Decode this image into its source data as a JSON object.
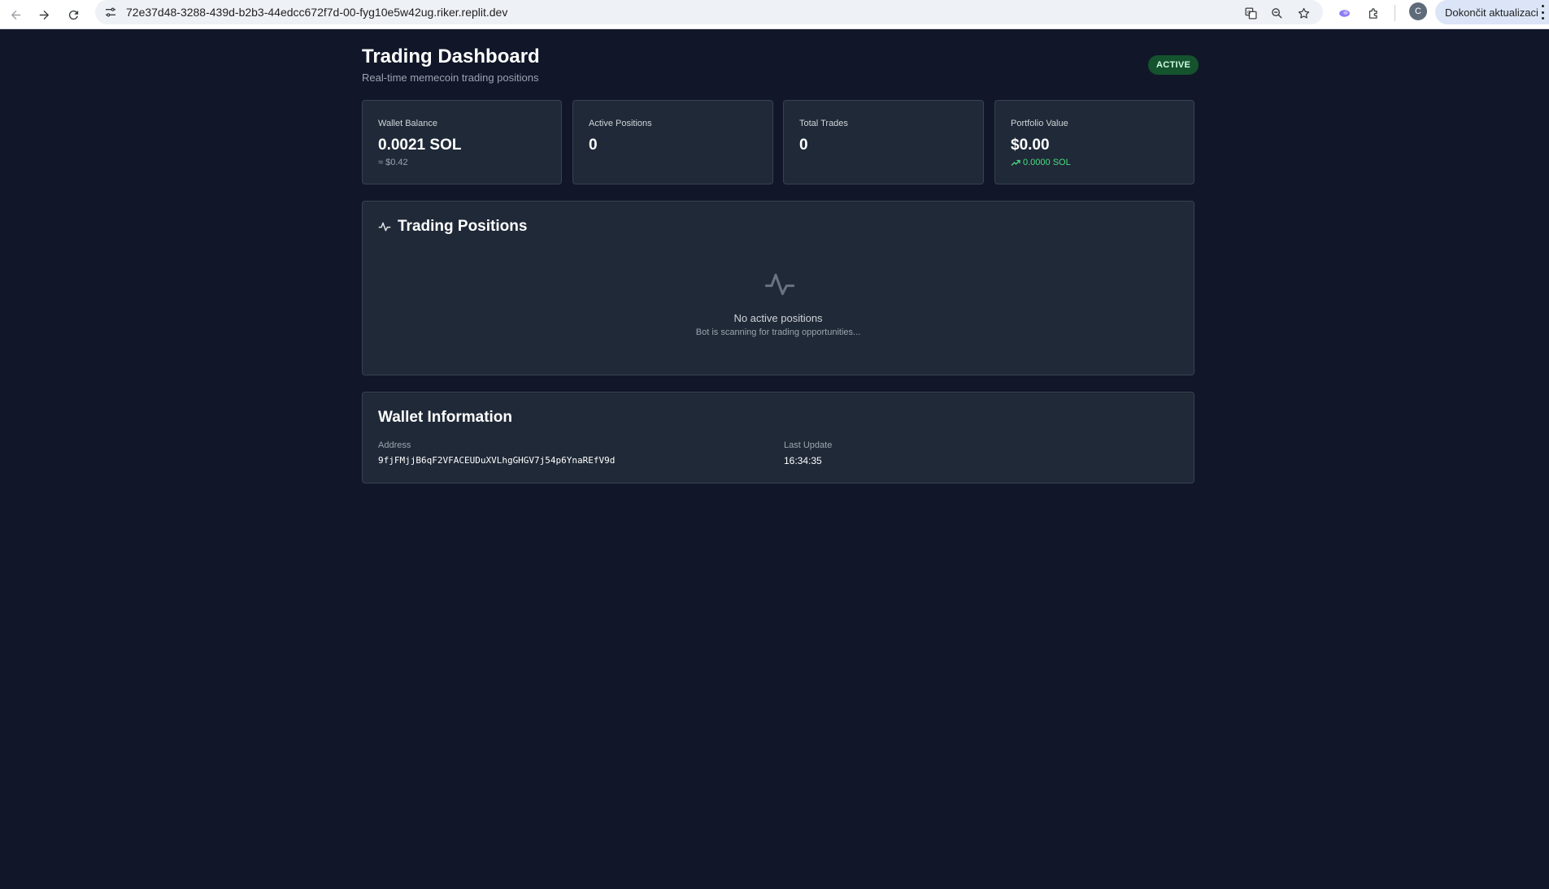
{
  "browser": {
    "url": "72e37d48-3288-439d-b2b3-44edcc672f7d-00-fyg10e5w42ug.riker.replit.dev",
    "profile_initial": "C",
    "update_button_label": "Dokončit aktualizaci",
    "icons": [
      "back-icon",
      "forward-icon",
      "reload-icon",
      "site-info-icon",
      "translate-icon",
      "zoom-icon",
      "bookmark-star-icon",
      "extension-icon",
      "puzzle-icon",
      "menu-dots-icon"
    ]
  },
  "header": {
    "title": "Trading Dashboard",
    "subtitle": "Real-time memecoin trading positions",
    "status": "ACTIVE"
  },
  "stats": [
    {
      "label": "Wallet Balance",
      "value": "0.0021 SOL",
      "sub": "≈ $0.42"
    },
    {
      "label": "Active Positions",
      "value": "0"
    },
    {
      "label": "Total Trades",
      "value": "0"
    },
    {
      "label": "Portfolio Value",
      "value": "$0.00",
      "sub": "0.0000 SOL"
    }
  ],
  "positions": {
    "title": "Trading Positions",
    "empty_title": "No active positions",
    "empty_subtitle": "Bot is scanning for trading opportunities..."
  },
  "wallet": {
    "title": "Wallet Information",
    "address_label": "Address",
    "address": "9fjFMjjB6qF2VFACEUDuXVLhgGHGV7j54p6YnaREfV9d",
    "update_label": "Last Update",
    "update_time": "16:34:35"
  },
  "colors": {
    "background": "#111729",
    "card": "#1f2937",
    "accent_green": "#4ade80",
    "badge_bg": "#14532d"
  }
}
